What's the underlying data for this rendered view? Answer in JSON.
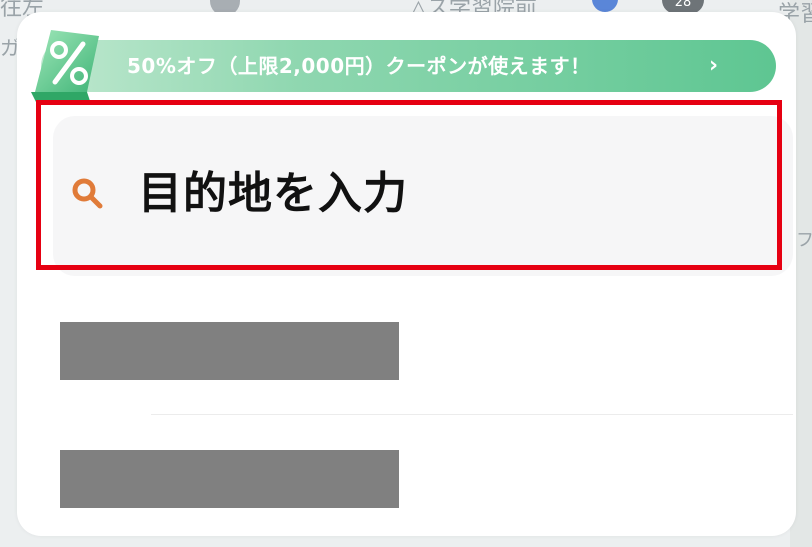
{
  "map": {
    "labels": [
      "往左",
      "ガ",
      "△ス学習院前",
      "学習",
      "フタ"
    ],
    "route_badge": "28"
  },
  "coupon": {
    "badge_icon": "percent-icon",
    "text": "50%オフ（上限2,000円）クーポンが使えます！",
    "arrow": "›"
  },
  "search": {
    "icon": "search-icon",
    "placeholder": "目的地を入力",
    "icon_color": "#e07b39"
  },
  "colors": {
    "highlight": "#e60012",
    "coupon_green": "#5ec692",
    "redacted": "#808080"
  }
}
